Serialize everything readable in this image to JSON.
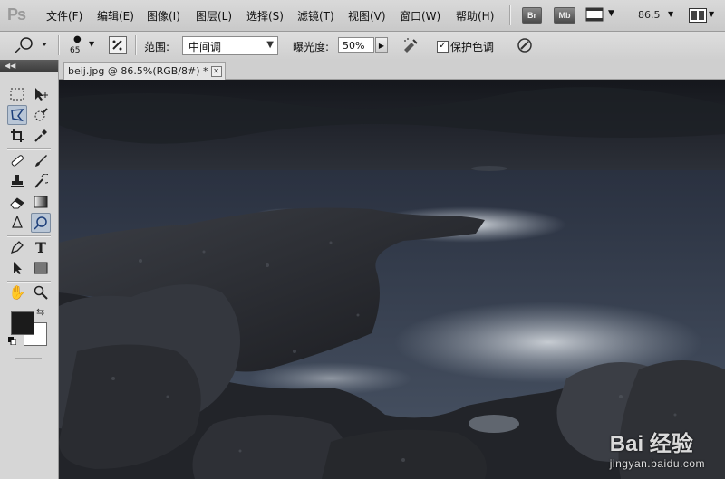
{
  "app": {
    "logo_text": "Ps",
    "menu": [
      "文件(F)",
      "编辑(E)",
      "图像(I)",
      "图层(L)",
      "选择(S)",
      "滤镜(T)",
      "视图(V)",
      "窗口(W)",
      "帮助(H)"
    ],
    "bridge_label": "Br",
    "minibridge_label": "Mb",
    "zoom_readout": "86.5"
  },
  "options_bar": {
    "brush_size": "65",
    "range_label": "范围:",
    "range_value": "中间调",
    "exposure_label": "曝光度:",
    "exposure_value": "50%",
    "protect_tones_label": "保护色调",
    "protect_tones_checked": true
  },
  "document": {
    "tab_title": "beij.jpg @ 86.5%(RGB/8#) *"
  },
  "tools": {
    "active_tool": "dodge-tool",
    "foreground_color": "#1b1b1b",
    "background_color": "#ffffff"
  },
  "watermark": {
    "main": "Bai 经验",
    "sub": "jingyan.baidu.com"
  }
}
